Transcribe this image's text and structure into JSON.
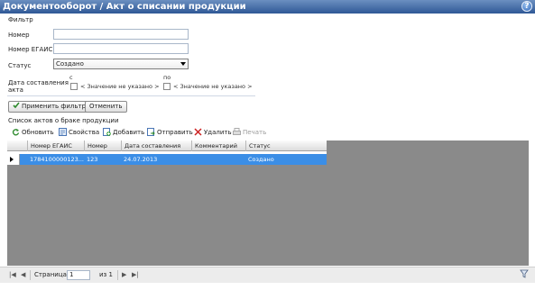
{
  "window": {
    "title": "Документооборот / Акт о списании продукции"
  },
  "filter": {
    "title": "Фильтр",
    "number_label": "Номер",
    "number_value": "",
    "egais_label": "Номер ЕГАИС",
    "egais_value": "",
    "status_label": "Статус",
    "status_value": "Создано",
    "date_label_line1": "Дата составления",
    "date_label_line2": "акта",
    "from_label": "с",
    "to_label": "по",
    "from_value": "< Значение не указано >",
    "to_value": "< Значение не указано >",
    "apply_button": "Применить фильтр",
    "cancel_button": "Отменить"
  },
  "list": {
    "title": "Список актов о браке продукции",
    "toolbar": {
      "refresh": "Обновить",
      "properties": "Свойства",
      "add": "Добавить",
      "send": "Отправить",
      "delete": "Удалить",
      "print": "Печать"
    },
    "columns": [
      "Номер ЕГАИС",
      "Номер",
      "Дата составления",
      "Комментарий",
      "Статус"
    ],
    "rows": [
      {
        "egais": "1784100000123...",
        "number": "123",
        "date": "24.07.2013",
        "comment": "",
        "status": "Создано"
      }
    ]
  },
  "pager": {
    "page_label": "Страница",
    "page_value": "1",
    "of_label": "из 1"
  },
  "icons": [
    "help-icon",
    "refresh-icon",
    "properties-icon",
    "add-icon",
    "send-icon",
    "delete-icon",
    "print-icon",
    "apply-filter-icon",
    "funnel-icon"
  ],
  "colors": {
    "titlebar": "#2f5896",
    "selected_row": "#3b8ee6",
    "grid_background": "#8a8a8a"
  }
}
